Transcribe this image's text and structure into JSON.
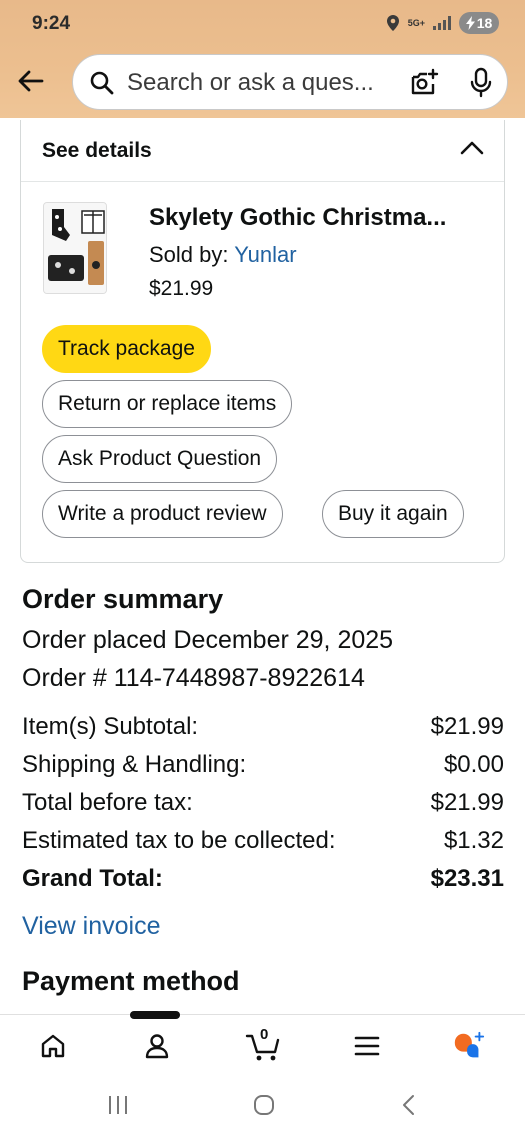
{
  "status_bar": {
    "time": "9:24",
    "network": "5G+",
    "battery": "18"
  },
  "search": {
    "placeholder": "Search or ask a ques..."
  },
  "item_card": {
    "details_label": "See details",
    "product_title": "Skylety Gothic Christma...",
    "sold_by_label": "Sold by:",
    "seller": "Yunlar",
    "price": "$21.99",
    "buttons": {
      "track": "Track package",
      "return": "Return or replace items",
      "ask": "Ask Product Question",
      "review": "Write a product review",
      "buy_again": "Buy it again"
    }
  },
  "order_summary": {
    "title": "Order summary",
    "placed_label": "Order placed",
    "placed_date": "December 29, 2025",
    "order_number_label": "Order #",
    "order_number": "114-7448987-8922614",
    "rows": [
      {
        "label": "Item(s) Subtotal:",
        "value": "$21.99"
      },
      {
        "label": "Shipping & Handling:",
        "value": "$0.00"
      },
      {
        "label": "Total before tax:",
        "value": "$21.99"
      },
      {
        "label": "Estimated tax to be collected:",
        "value": "$1.32"
      },
      {
        "label": "Grand Total:",
        "value": "$23.31"
      }
    ],
    "invoice_link": "View invoice"
  },
  "payment": {
    "title": "Payment method"
  },
  "bottom_nav": {
    "cart_count": "0"
  },
  "colors": {
    "header": "#ecbf8f",
    "primary_button": "#ffd814",
    "link": "#2162a1",
    "assistant_orange": "#f26b21",
    "assistant_blue": "#1a73e8"
  }
}
